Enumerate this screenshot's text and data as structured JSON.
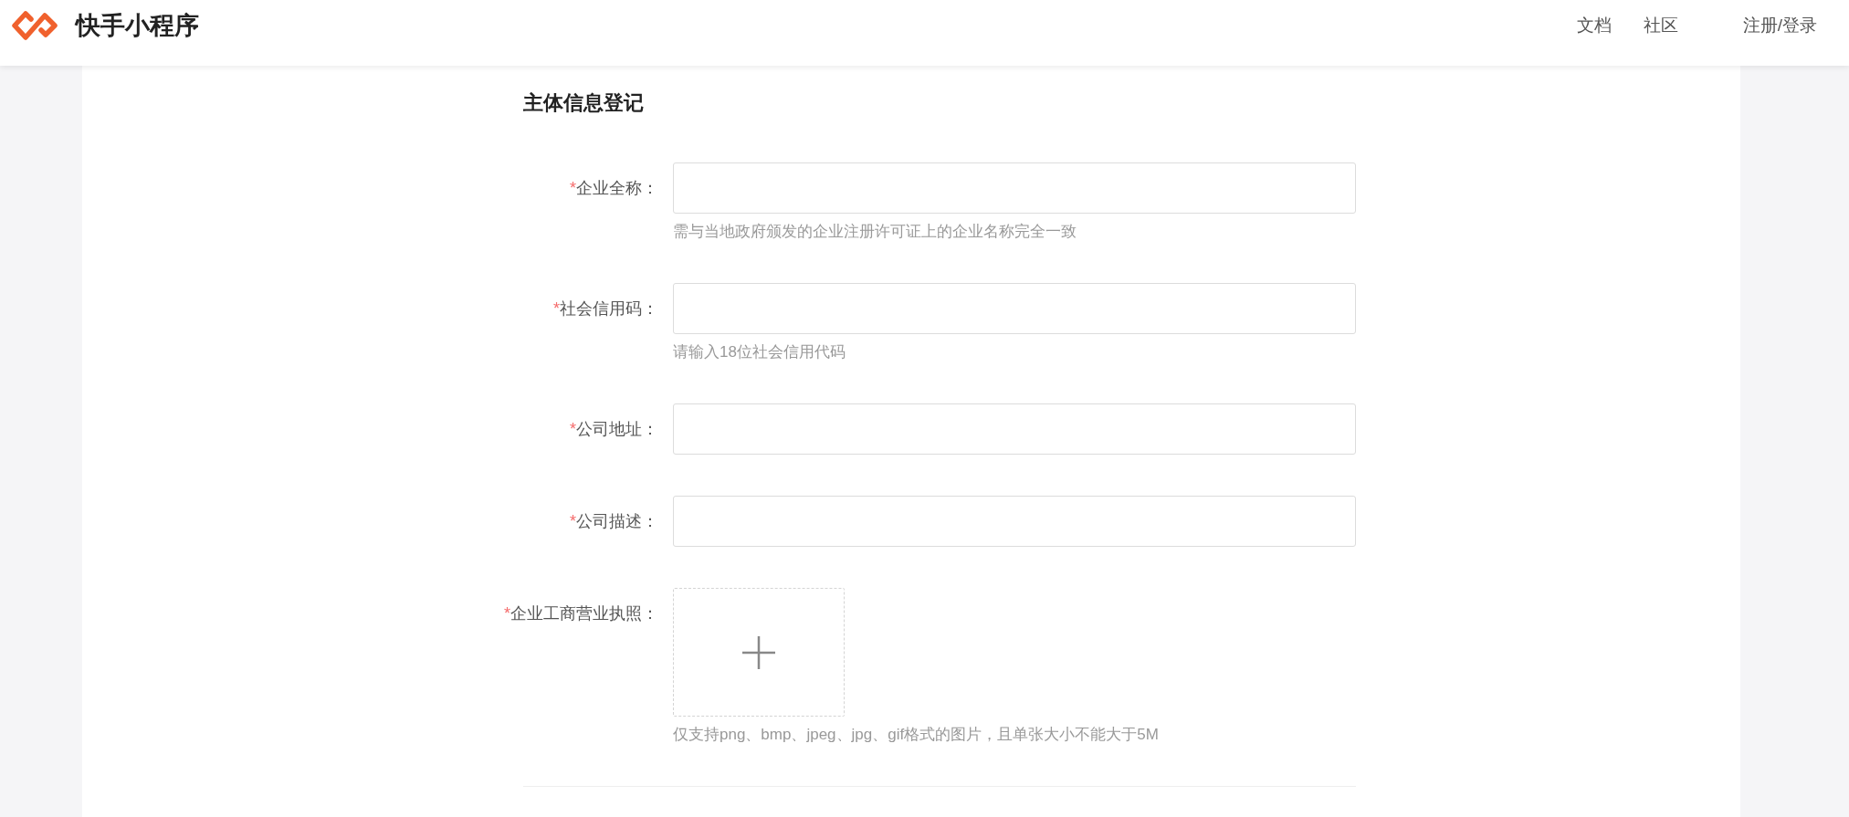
{
  "header": {
    "site_title": "快手小程序",
    "nav": [
      {
        "label": "文档"
      },
      {
        "label": "社区"
      }
    ],
    "auth_link": "注册/登录"
  },
  "form": {
    "title": "主体信息登记",
    "fields": [
      {
        "kind": "text",
        "required_mark": "*",
        "label": "企业全称：",
        "hint": "需与当地政府颁发的企业注册许可证上的企业名称完全一致"
      },
      {
        "kind": "text",
        "required_mark": "*",
        "label": "社会信用码：",
        "hint": "请输入18位社会信用代码"
      },
      {
        "kind": "text",
        "required_mark": "*",
        "label": "公司地址："
      },
      {
        "kind": "text",
        "required_mark": "*",
        "label": "公司描述："
      },
      {
        "kind": "upload",
        "required_mark": "*",
        "label": "企业工商营业执照：",
        "hint": "仅支持png、bmp、jpeg、jpg、gif格式的图片，且单张大小不能大于5M"
      }
    ]
  }
}
